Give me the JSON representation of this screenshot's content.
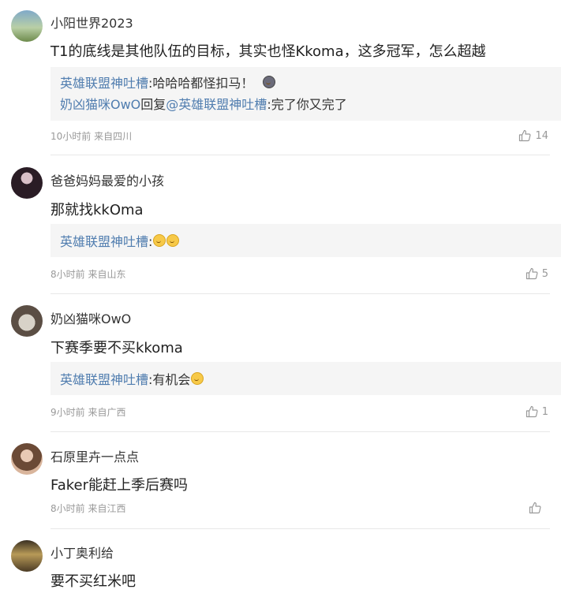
{
  "comments": [
    {
      "username": "小阳世界2023",
      "content": "T1的底线是其他队伍的目标，其实也怪Kkoma，这多冠军，怎么超越",
      "replies": [
        {
          "author": "英雄联盟神吐槽",
          "text": ":哈哈哈都怪扣马！"
        },
        {
          "author": "奶凶猫咪OwO",
          "reply_word": "回复",
          "reply_to": "@英雄联盟神吐槽",
          "text": ":完了你又完了"
        }
      ],
      "time": "10小时前",
      "location": "来自四川",
      "likes": "14"
    },
    {
      "username": "爸爸妈妈最爱的小孩",
      "content": "那就找kkOma",
      "replies": [
        {
          "author": "英雄联盟神吐槽",
          "text": ":"
        }
      ],
      "time": "8小时前",
      "location": "来自山东",
      "likes": "5"
    },
    {
      "username": "奶凶猫咪OwO",
      "content": "下赛季要不买kkoma",
      "replies": [
        {
          "author": "英雄联盟神吐槽",
          "text": ":有机会"
        }
      ],
      "time": "9小时前",
      "location": "来自广西",
      "likes": "1"
    },
    {
      "username": "石原里卉一点点",
      "content": "Faker能赶上季后赛吗",
      "replies": [],
      "time": "8小时前",
      "location": "来自江西",
      "likes": ""
    },
    {
      "username": "小丁奥利给",
      "content": "要不买红米吧",
      "replies": [],
      "time": "",
      "location": "",
      "likes": ""
    }
  ],
  "icons": {
    "like": "thumbs-up-icon",
    "emoji": "smiley-emoji-icon"
  },
  "colors": {
    "link": "#507daf",
    "meta": "#999999",
    "reply_bg": "#f5f5f5"
  }
}
